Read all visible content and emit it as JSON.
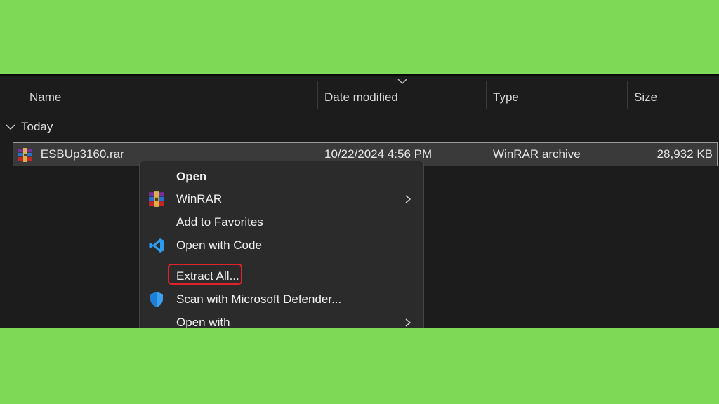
{
  "columns": {
    "name": "Name",
    "date_modified": "Date modified",
    "type": "Type",
    "size": "Size"
  },
  "group": {
    "label": "Today",
    "chevron_icon": "chevron-down-icon"
  },
  "file": {
    "name": "ESBUp3160.rar",
    "date": "10/22/2024 4:56 PM",
    "type": "WinRAR archive",
    "size": "28,932 KB",
    "icon": "winrar-icon"
  },
  "context_menu": {
    "items": [
      {
        "label": "Open",
        "icon": "",
        "submenu": false,
        "bold": true
      },
      {
        "label": "WinRAR",
        "icon": "winrar-icon",
        "submenu": true
      },
      {
        "label": "Add to Favorites",
        "icon": "",
        "submenu": false
      },
      {
        "label": "Open with Code",
        "icon": "vscode-icon",
        "submenu": false
      },
      {
        "label": "Extract All...",
        "icon": "",
        "submenu": false,
        "highlighted": true
      },
      {
        "label": "Scan with Microsoft Defender...",
        "icon": "defender-shield-icon",
        "submenu": false
      },
      {
        "label": "Open with",
        "icon": "",
        "submenu": true
      }
    ]
  },
  "colors": {
    "background": "#7ed957",
    "explorer_bg": "#1c1c1c",
    "menu_bg": "#2b2b2b",
    "highlight": "#e0222a",
    "vscode_blue": "#2d9cf0",
    "defender_blue": "#1f7fd6"
  }
}
